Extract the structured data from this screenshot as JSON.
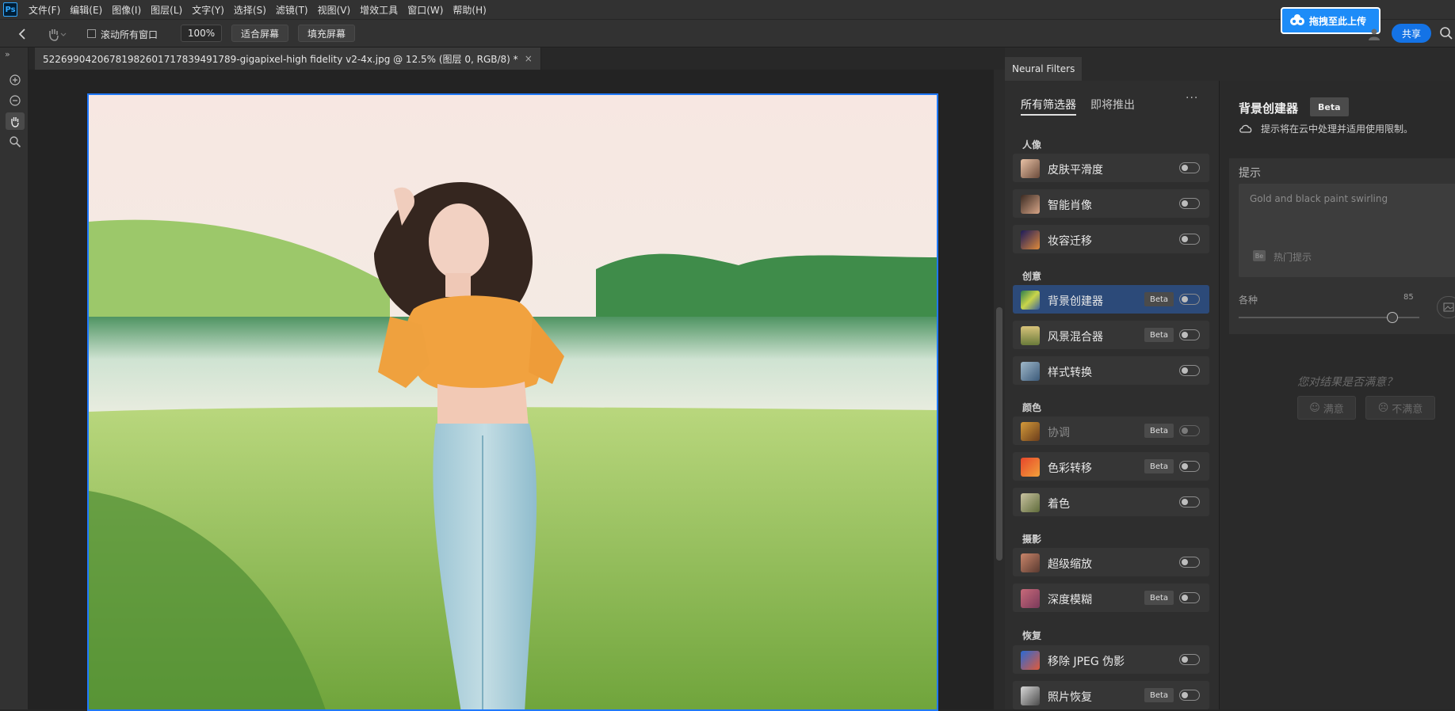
{
  "app_logo": "Ps",
  "menu": [
    "文件(F)",
    "编辑(E)",
    "图像(I)",
    "图层(L)",
    "文字(Y)",
    "选择(S)",
    "滤镜(T)",
    "视图(V)",
    "增效工具",
    "窗口(W)",
    "帮助(H)"
  ],
  "options_bar": {
    "scroll_all_label": "滚动所有窗口",
    "zoom_value": "100%",
    "fit_screen": "适合屏幕",
    "fill_screen": "填充屏幕"
  },
  "upload_badge": "拖拽至此上传",
  "share_button": "共享",
  "document_tab": {
    "title": "5226990420678198260171783949178​9-gigapixel-high fidelity v2-4x.jpg @ 12.5% (图层 0, RGB/8) *",
    "close": "×"
  },
  "neural_filters": {
    "panel_tab": "Neural Filters",
    "tabs": [
      "所有筛选器",
      "即将推出"
    ],
    "more": "···",
    "categories": [
      {
        "label": "人像",
        "filters": [
          {
            "name": "皮肤平滑度",
            "beta": false,
            "dim": false,
            "selected": false
          },
          {
            "name": "智能肖像",
            "beta": false,
            "dim": false,
            "selected": false
          },
          {
            "name": "妆容迁移",
            "beta": false,
            "dim": false,
            "selected": false
          }
        ]
      },
      {
        "label": "创意",
        "filters": [
          {
            "name": "背景创建器",
            "beta": true,
            "dim": false,
            "selected": true
          },
          {
            "name": "风景混合器",
            "beta": true,
            "dim": false,
            "selected": false
          },
          {
            "name": "样式转换",
            "beta": false,
            "dim": false,
            "selected": false
          }
        ]
      },
      {
        "label": "颜色",
        "filters": [
          {
            "name": "协调",
            "beta": true,
            "dim": true,
            "selected": false
          },
          {
            "name": "色彩转移",
            "beta": true,
            "dim": false,
            "selected": false
          },
          {
            "name": "着色",
            "beta": false,
            "dim": false,
            "selected": false
          }
        ]
      },
      {
        "label": "摄影",
        "filters": [
          {
            "name": "超级缩放",
            "beta": false,
            "dim": false,
            "selected": false
          },
          {
            "name": "深度模糊",
            "beta": true,
            "dim": false,
            "selected": false
          }
        ]
      },
      {
        "label": "恢复",
        "filters": [
          {
            "name": "移除 JPEG 伪影",
            "beta": false,
            "dim": false,
            "selected": false
          },
          {
            "name": "照片恢复",
            "beta": true,
            "dim": false,
            "selected": false
          }
        ]
      }
    ],
    "beta_label": "Beta",
    "detail": {
      "title": "背景创建器",
      "beta": "Beta",
      "cloud_note": "提示将在云中处理并适用使用限制。",
      "prompt_header": "提示",
      "prompt_text": "Gold and black paint swirling",
      "hot_prompts": "热门提示",
      "seed_label": "各种",
      "seed_value": "85",
      "seed_fraction": 0.85,
      "satisfaction_q": "您对结果是否满意？",
      "satisfied": "满意",
      "unsatisfied": "不满意"
    }
  },
  "colors": {
    "accent": "#1473e6",
    "selected_row": "#2c4a79",
    "canvas_border": "#1f78ff"
  }
}
